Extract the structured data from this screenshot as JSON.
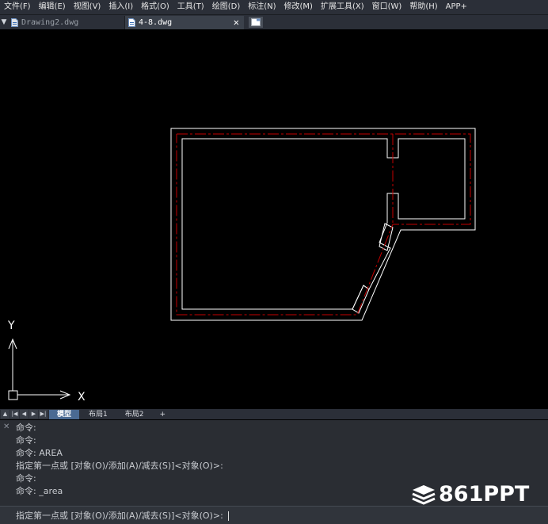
{
  "menu": [
    "文件(F)",
    "编辑(E)",
    "视图(V)",
    "插入(I)",
    "格式(O)",
    "工具(T)",
    "绘图(D)",
    "标注(N)",
    "修改(M)",
    "扩展工具(X)",
    "窗口(W)",
    "帮助(H)",
    "APP+"
  ],
  "tabs": {
    "inactive_label": "Drawing2.dwg",
    "active_label": "4-8.dwg",
    "close_symbol": "✕"
  },
  "ucs": {
    "x_label": "X",
    "y_label": "Y"
  },
  "layout_tabs": [
    "模型",
    "布局1",
    "布局2",
    "+"
  ],
  "command_history": [
    "命令:",
    "命令:",
    "命令: AREA",
    "指定第一点或 [对象(O)/添加(A)/减去(S)]<对象(O)>:",
    "命令:",
    "命令: _area"
  ],
  "command_prompt": "指定第一点或 [对象(O)/添加(A)/减去(S)]<对象(O)>:",
  "watermark": "861PPT",
  "colors": {
    "background": "#000000",
    "wall": "#ffffff",
    "axis": "#c40000",
    "active_tab": "#4a6a93"
  }
}
